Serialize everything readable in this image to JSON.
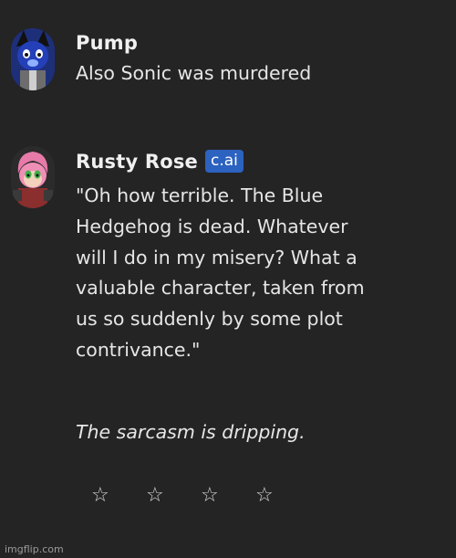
{
  "messages": [
    {
      "author": "Pump",
      "text": "Also Sonic was murdered",
      "avatar_icon": "wolf-character-avatar"
    },
    {
      "author": "Rusty Rose",
      "badge": "c.ai",
      "lines": [
        "\"Oh how terrible. The Blue",
        "Hedgehog is dead. Whatever",
        "will I do in my misery? What a",
        "valuable character, taken from",
        "us so suddenly by some plot",
        "contrivance.\""
      ],
      "narration": "The sarcasm is dripping.",
      "avatar_icon": "rusty-rose-robot-avatar"
    }
  ],
  "rating": {
    "stars": [
      "☆",
      "☆",
      "☆",
      "☆"
    ]
  },
  "watermark": "imgflip.com",
  "colors": {
    "background": "#242424",
    "badge": "#2c62c0",
    "text": "#e6e6e6"
  }
}
